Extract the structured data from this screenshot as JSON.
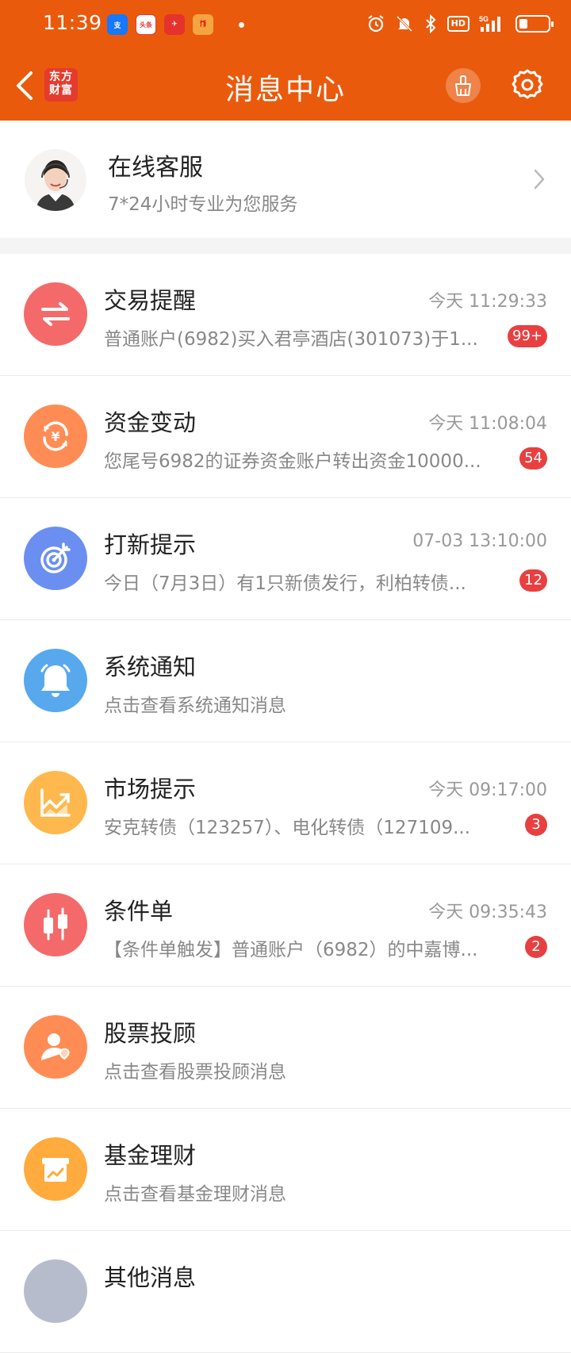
{
  "status_bar": {
    "time": "11:39",
    "notification_apps": [
      "支付宝",
      "头条",
      "",
      "红包"
    ],
    "network": "5G",
    "hd_label": "HD"
  },
  "header": {
    "title": "消息中心",
    "logo_text_line1": "东方",
    "logo_text_line2": "财富",
    "accent_color": "#ea5a0c"
  },
  "customer_service": {
    "name": "在线客服",
    "subtitle": "7*24小时专业为您服务"
  },
  "messages": [
    {
      "name": "交易提醒",
      "time": "今天 11:29:33",
      "preview": "普通账户(6982)买入君亭酒店(301073)于1...",
      "badge": "99+",
      "icon": "exchange-arrows-icon",
      "color": "#f46a6a"
    },
    {
      "name": "资金变动",
      "time": "今天 11:08:04",
      "preview": "您尾号6982的证券资金账户转出资金10000...",
      "badge": "54",
      "icon": "yuan-refresh-icon",
      "color": "#ff8c55"
    },
    {
      "name": "打新提示",
      "time": "07-03 13:10:00",
      "preview": "今日（7月3日）有1只新债发行，利柏转债...",
      "badge": "12",
      "icon": "target-icon",
      "color": "#6a8ff0"
    },
    {
      "name": "系统通知",
      "time": "",
      "preview": "点击查看系统通知消息",
      "badge": "",
      "icon": "bell-icon",
      "color": "#58a8ee"
    },
    {
      "name": "市场提示",
      "time": "今天 09:17:00",
      "preview": "安克转债（123257）、电化转债（127109...",
      "badge": "3",
      "icon": "trend-chart-icon",
      "color": "#ffb84d"
    },
    {
      "name": "条件单",
      "time": "今天 09:35:43",
      "preview": "【条件单触发】普通账户（6982）的中嘉博...",
      "badge": "2",
      "icon": "candlestick-icon",
      "color": "#f46a6a"
    },
    {
      "name": "股票投顾",
      "time": "",
      "preview": "点击查看股票投顾消息",
      "badge": "",
      "icon": "advisor-icon",
      "color": "#ff8c55"
    },
    {
      "name": "基金理财",
      "time": "",
      "preview": "点击查看基金理财消息",
      "badge": "",
      "icon": "fund-box-icon",
      "color": "#ffab3d"
    },
    {
      "name": "其他消息",
      "time": "",
      "preview": "",
      "badge": "",
      "icon": "other-icon",
      "color": "#b7bccc"
    }
  ]
}
